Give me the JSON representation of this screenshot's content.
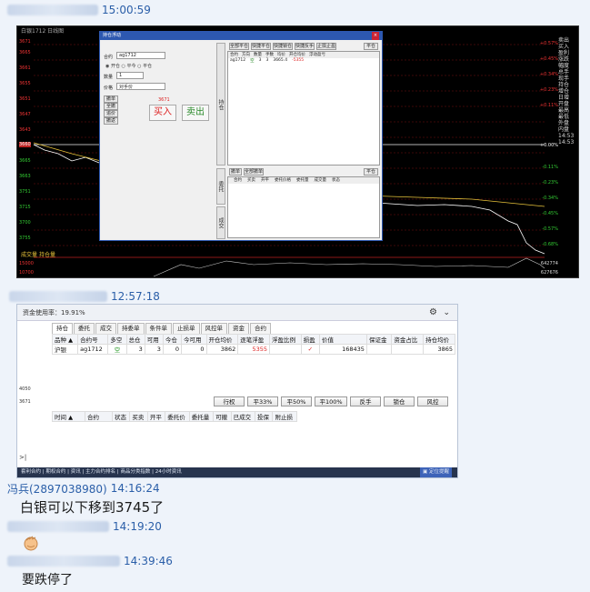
{
  "messages": [
    {
      "time": "15:00:59"
    },
    {
      "time": "12:57:18"
    },
    {
      "sender": "冯兵(2897038980)",
      "time": "14:16:24",
      "text": "白银可以下移到3745了"
    },
    {
      "time": "14:19:20"
    },
    {
      "time": "14:39:46",
      "text": "要跌停了"
    }
  ],
  "chart": {
    "top_info": "白银1712 日线图",
    "left_axis": [
      "3671",
      "3665",
      "3661",
      "3655",
      "3651",
      "3647",
      "3643",
      "3639",
      "3665",
      "3663",
      "3751",
      "3715",
      "3700",
      "3755",
      "3749",
      "3739",
      "3727",
      "3720",
      "15000",
      "10700"
    ],
    "right_pcts": [
      "+0.57%",
      "+0.45%",
      "+0.34%",
      "+0.23%",
      "+0.11%",
      "+0.00%",
      "-0.11%",
      "-0.23%",
      "-0.34%",
      "-0.45%",
      "-0.57%",
      "-0.68%",
      "-0.79%",
      "-0.91%"
    ],
    "right_menu": [
      "卖出",
      "买入",
      "盈利",
      "涨跌",
      "幅度",
      "总手",
      "现手",
      "持仓",
      "增仓",
      "日增",
      "开盘",
      "最高",
      "最低",
      "外盘",
      "内盘",
      "14:53",
      "14:53"
    ],
    "bottom_labels": [
      "成交量",
      "持仓量"
    ],
    "bottom_right": [
      "642774",
      "627676"
    ],
    "price_tag": "3660"
  },
  "order_dialog": {
    "title": "持仓浮动",
    "contract_label": "合约",
    "contract_value": "ag1712",
    "qty_label": "数量",
    "qty_value": "1",
    "price_label": "价格",
    "price_value": "对手价",
    "price_hint": "3671",
    "buy_label": "买入",
    "sell_label": "卖出",
    "left_btns": [
      "撤单",
      "全撤",
      "追价",
      "撤返"
    ],
    "radio_open": "开仓",
    "radio_close": "平今",
    "radio_closeold": "平仓",
    "tab_vertical_1": "持仓",
    "tab_vertical_2": "委托",
    "tab_vertical_3": "成交",
    "grid_cols": [
      "合约",
      "方向",
      "数量",
      "手数",
      "均价",
      "开仓均价",
      "浮动盈亏"
    ],
    "grid_row": [
      "ag1712",
      "空",
      "3",
      "3",
      "3665.4",
      "-5355"
    ],
    "top_btns": [
      "全部平仓",
      "快捷平仓",
      "快捷锁仓",
      "快捷反手",
      "止损止盈"
    ],
    "second_btns": [
      "撤单",
      "全部撤单"
    ],
    "second_cols": [
      "合约",
      "买卖",
      "开平",
      "委托价格",
      "委托量",
      "成交量",
      "状态"
    ],
    "close_btn": "平仓"
  },
  "panel2": {
    "header": "资金使用率：19.91%",
    "tabs": [
      "持仓",
      "委托",
      "成交",
      "持委单",
      "条件单",
      "止损单",
      "风控单",
      "资金",
      "合约"
    ],
    "columns": [
      "品种 ▲",
      "合约号",
      "多空",
      "总仓",
      "可用",
      "今仓",
      "今可用",
      "开仓均价",
      "逐笔浮盈",
      "浮盈比例",
      "损盈",
      "价值",
      "保证金",
      "资金占比",
      "持仓均价"
    ],
    "row": [
      "沪银",
      "ag1712",
      "空",
      "3",
      "3",
      "0",
      "0",
      "3862",
      "5355",
      "",
      "✓",
      "168435",
      "",
      "",
      "3865"
    ],
    "buttons": [
      "行权",
      "平33%",
      "平50%",
      "平100%",
      "反手",
      "锁仓",
      "风控"
    ],
    "lower_columns": [
      "时间 ▲",
      "合约",
      "状态",
      "买卖",
      "开平",
      "委托价",
      "委托量",
      "可撤",
      "已成交",
      "投保",
      "附止损"
    ],
    "left_labels": [
      "4050",
      "3671"
    ],
    "status": "套利合约 | 期权合约 | 资讯 | 主力合约排名 | 商品分类指数 | 24小时资讯",
    "status_right": "▣ 定位提醒"
  }
}
